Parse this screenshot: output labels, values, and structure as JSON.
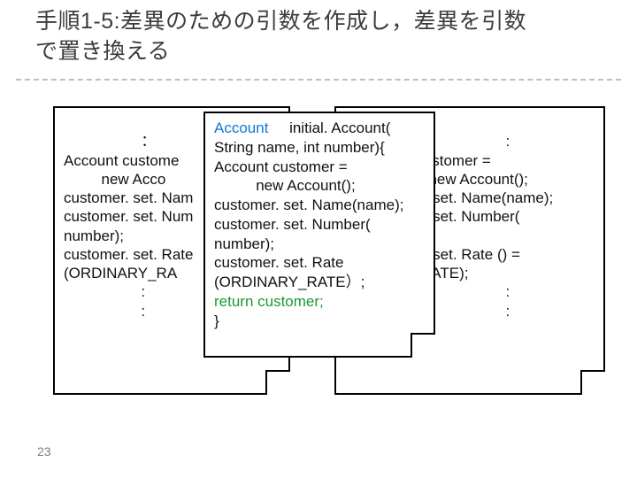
{
  "title_line1": "手順1-5:差異のための引数を作成し，差異を引数",
  "title_line2": "で置き換える",
  "page_number": "23",
  "card_a": {
    "lines": [
      "             ：",
      "Account custome",
      "         new Acco",
      "customer. set. Nam",
      "customer. set. Num",
      "number);",
      "customer. set. Rate",
      "(ORDINARY_RA",
      "             :",
      "             :"
    ]
  },
  "card_b": {
    "lines": [
      "                           :",
      "                 customer =",
      "                    new Account();",
      "                  r. set. Name(name);",
      "                  r. set. Number(",
      "                 ;",
      "                  r. set. Rate () =",
      "                  RATE);",
      "                           :",
      "                           :"
    ]
  },
  "card_c": {
    "type": "Account",
    "method": "initial. Account(",
    "sig2": "String name, int number){",
    "l3": "Account customer =",
    "l4": "          new Account();",
    "l5": "customer. set. Name(name);",
    "l6": "customer. set. Number(",
    "l7": "number);",
    "l8": "customer. set. Rate",
    "l9": "(ORDINARY_RATE）;",
    "ret": "return customer;",
    "l11": "}"
  }
}
